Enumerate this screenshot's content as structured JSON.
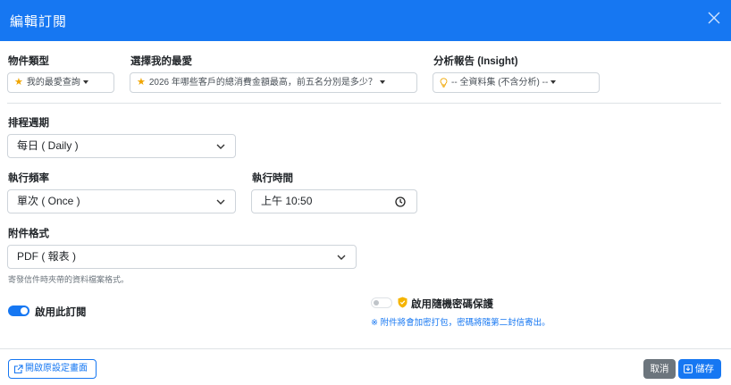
{
  "modal": {
    "title": "編輯訂閱"
  },
  "fields": {
    "object_type": {
      "label": "物件類型",
      "value": "我的最愛查詢"
    },
    "favorite": {
      "label": "選擇我的最愛",
      "value": "2026 年哪些客戶的總消費金額最高，前五名分別是多少？"
    },
    "insight": {
      "label": "分析報告 (Insight)",
      "value": "-- 全資料集 (不含分析) --"
    },
    "schedule_cycle": {
      "label": "排程週期",
      "value": "每日 ( Daily )"
    },
    "frequency": {
      "label": "執行頻率",
      "value": "單次 ( Once )"
    },
    "exec_time": {
      "label": "執行時間",
      "value": "上午 10:50"
    },
    "attachment_format": {
      "label": "附件格式",
      "value": "PDF ( 報表 )",
      "hint": "寄發信件時夾帶的資料檔案格式。"
    }
  },
  "toggles": {
    "enable_subscription": {
      "label": "啟用此訂閱",
      "on": true
    },
    "password_protect": {
      "label": "啟用隨機密碼保護",
      "on": false,
      "note": "※ 附件將會加密打包，密碼將隨第二封信寄出。"
    }
  },
  "footer": {
    "open_settings_label": "開啟原設定畫面",
    "cancel_label": "取消",
    "save_label": "儲存"
  },
  "colors": {
    "primary": "#1677f2",
    "secondary": "#6c757d",
    "star": "#f0a500",
    "shield": "#f5b400"
  },
  "icons": {
    "close": "close-icon",
    "star": "star-icon",
    "bulb": "lightbulb-icon",
    "chevron": "chevron-down-icon",
    "clock": "clock-icon",
    "shield": "shield-icon",
    "external": "external-link-icon",
    "save": "save-icon"
  }
}
